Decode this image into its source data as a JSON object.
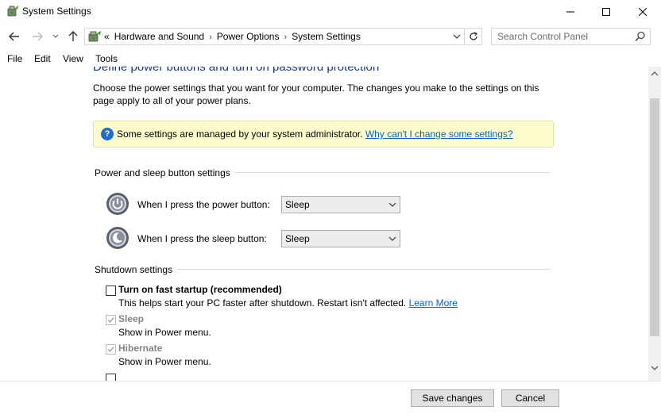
{
  "window": {
    "title": "System Settings",
    "controls": {
      "minimize": "minimize-icon",
      "maximize": "maximize-icon",
      "close": "close-icon"
    }
  },
  "address_bar": {
    "overflow": "«",
    "crumbs": [
      "Hardware and Sound",
      "Power Options",
      "System Settings"
    ]
  },
  "search": {
    "placeholder": "Search Control Panel"
  },
  "menu": [
    "File",
    "Edit",
    "View",
    "Tools"
  ],
  "page": {
    "heading": "Define power buttons and turn on password protection",
    "description": "Choose the power settings that you want for your computer. The changes you make to the settings on this page apply to all of your power plans.",
    "info": {
      "text": "Some settings are managed by your system administrator.",
      "link": "Why can't I change some settings?"
    },
    "power_group": {
      "title": "Power and sleep button settings",
      "rows": [
        {
          "label": "When I press the power button:",
          "value": "Sleep"
        },
        {
          "label": "When I press the sleep button:",
          "value": "Sleep"
        }
      ]
    },
    "shutdown_group": {
      "title": "Shutdown settings",
      "fast_startup": {
        "title": "Turn on fast startup (recommended)",
        "desc": "This helps start your PC faster after shutdown. Restart isn't affected.",
        "link": "Learn More",
        "checked": false
      },
      "sleep": {
        "title": "Sleep",
        "desc": "Show in Power menu.",
        "checked": true
      },
      "hibernate": {
        "title": "Hibernate",
        "desc": "Show in Power menu.",
        "checked": true
      }
    }
  },
  "footer": {
    "save": "Save changes",
    "cancel": "Cancel"
  },
  "colors": {
    "heading": "#1e3287",
    "link": "#0066cc",
    "info_bg": "#fbfbcc"
  }
}
